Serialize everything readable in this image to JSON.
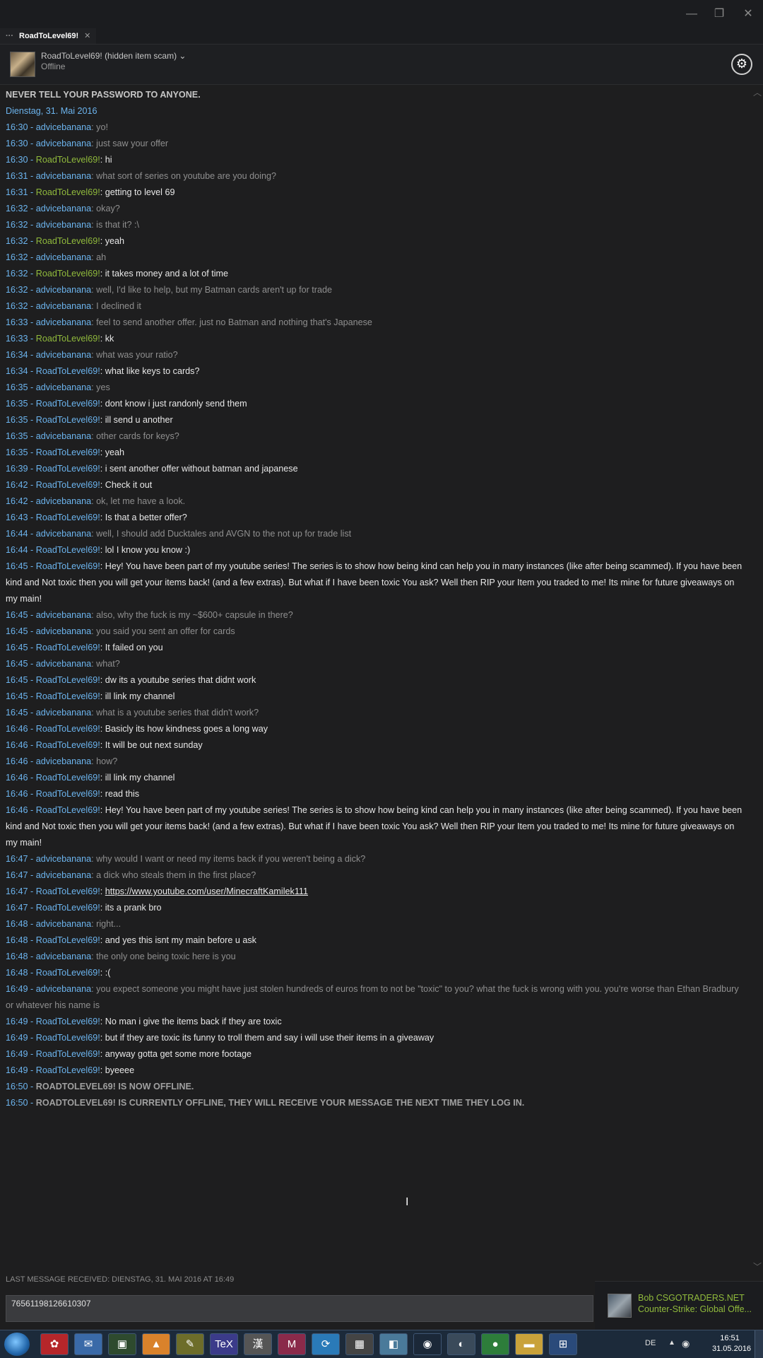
{
  "window": {
    "minimize": "—",
    "restore": "❐",
    "close": "✕"
  },
  "tab": {
    "dots": "···",
    "label": "RoadToLevel69!",
    "close": "✕"
  },
  "header": {
    "contact_name": "RoadToLevel69! (hidden item scam) ⌄",
    "status": "Offline",
    "settings": "⚙"
  },
  "chat": {
    "warning": "NEVER TELL YOUR PASSWORD TO ANYONE.",
    "date": "Dienstag, 31. Mai 2016",
    "messages": [
      {
        "t": "16:30",
        "n": "advicebanana",
        "s": "them",
        "m": "yo!"
      },
      {
        "t": "16:30",
        "n": "advicebanana",
        "s": "them",
        "m": "just saw your offer"
      },
      {
        "t": "16:30",
        "n": "RoadToLevel69!",
        "s": "other",
        "m": "hi"
      },
      {
        "t": "16:31",
        "n": "advicebanana",
        "s": "them",
        "m": "what sort of series on youtube are you doing?"
      },
      {
        "t": "16:31",
        "n": "RoadToLevel69!",
        "s": "other",
        "m": "getting to level 69"
      },
      {
        "t": "16:32",
        "n": "advicebanana",
        "s": "them",
        "m": "okay?"
      },
      {
        "t": "16:32",
        "n": "advicebanana",
        "s": "them",
        "m": "is that it? :\\"
      },
      {
        "t": "16:32",
        "n": "RoadToLevel69!",
        "s": "other",
        "m": "yeah"
      },
      {
        "t": "16:32",
        "n": "advicebanana",
        "s": "them",
        "m": "ah"
      },
      {
        "t": "16:32",
        "n": "RoadToLevel69!",
        "s": "other",
        "m": "it takes money and a lot of time"
      },
      {
        "t": "16:32",
        "n": "advicebanana",
        "s": "them",
        "m": "well, I'd like to help, but my Batman cards aren't up for trade"
      },
      {
        "t": "16:32",
        "n": "advicebanana",
        "s": "them",
        "m": "I declined it"
      },
      {
        "t": "16:33",
        "n": "advicebanana",
        "s": "them",
        "m": "feel to send another offer. just no Batman and nothing that's Japanese"
      },
      {
        "t": "16:33",
        "n": "RoadToLevel69!",
        "s": "other",
        "m": "kk"
      },
      {
        "t": "16:34",
        "n": "advicebanana",
        "s": "them",
        "m": "what was your ratio?"
      },
      {
        "t": "16:34",
        "n": "RoadToLevel69!",
        "s": "me",
        "m": "what like keys to cards?"
      },
      {
        "t": "16:35",
        "n": "advicebanana",
        "s": "them",
        "m": "yes"
      },
      {
        "t": "16:35",
        "n": "RoadToLevel69!",
        "s": "me",
        "m": "dont know i just randonly send them"
      },
      {
        "t": "16:35",
        "n": "RoadToLevel69!",
        "s": "me",
        "m": "ill send u another"
      },
      {
        "t": "16:35",
        "n": "advicebanana",
        "s": "them",
        "m": "other cards for keys?"
      },
      {
        "t": "16:35",
        "n": "RoadToLevel69!",
        "s": "me",
        "m": "yeah"
      },
      {
        "t": "16:39",
        "n": "RoadToLevel69!",
        "s": "me",
        "m": "i sent another offer without batman and japanese"
      },
      {
        "t": "16:42",
        "n": "RoadToLevel69!",
        "s": "me",
        "m": "Check it out"
      },
      {
        "t": "16:42",
        "n": "advicebanana",
        "s": "them",
        "m": "ok, let me have a look."
      },
      {
        "t": "16:43",
        "n": "RoadToLevel69!",
        "s": "me",
        "m": "Is that a better offer?"
      },
      {
        "t": "16:44",
        "n": "advicebanana",
        "s": "them",
        "m": "well, I should add Ducktales and AVGN to the not up for trade list"
      },
      {
        "t": "16:44",
        "n": "RoadToLevel69!",
        "s": "me",
        "m": "lol I know you know :)"
      },
      {
        "t": "16:45",
        "n": "RoadToLevel69!",
        "s": "me",
        "m": "Hey! You have been part of my youtube series! The series is to show how being kind can help you in many instances (like after being scammed). If you have been kind and Not toxic then you will get your items back! (and a few extras). But what if I have been toxic You ask? Well then RIP your Item you traded to me! Its mine for future giveaways on my main!"
      },
      {
        "t": "16:45",
        "n": "advicebanana",
        "s": "them",
        "m": "also, why  the fuck is my ~$600+ capsule in there?"
      },
      {
        "t": "16:45",
        "n": "advicebanana",
        "s": "them",
        "m": "you said you sent an offer for cards"
      },
      {
        "t": "16:45",
        "n": "RoadToLevel69!",
        "s": "me",
        "m": "It failed on you"
      },
      {
        "t": "16:45",
        "n": "advicebanana",
        "s": "them",
        "m": "what?"
      },
      {
        "t": "16:45",
        "n": "RoadToLevel69!",
        "s": "me",
        "m": "dw its a youtube series that didnt work"
      },
      {
        "t": "16:45",
        "n": "RoadToLevel69!",
        "s": "me",
        "m": "ill link my channel"
      },
      {
        "t": "16:45",
        "n": "advicebanana",
        "s": "them",
        "m": "what is a youtube series that didn't work?"
      },
      {
        "t": "16:46",
        "n": "RoadToLevel69!",
        "s": "me",
        "m": "Basicly its how kindness goes a long way"
      },
      {
        "t": "16:46",
        "n": "RoadToLevel69!",
        "s": "me",
        "m": "It will be out next sunday"
      },
      {
        "t": "16:46",
        "n": "advicebanana",
        "s": "them",
        "m": "how?"
      },
      {
        "t": "16:46",
        "n": "RoadToLevel69!",
        "s": "me",
        "m": "ill link my channel"
      },
      {
        "t": "16:46",
        "n": "RoadToLevel69!",
        "s": "me",
        "m": "read this"
      },
      {
        "t": "16:46",
        "n": "RoadToLevel69!",
        "s": "me",
        "m": "Hey! You have been part of my youtube series! The series is to show how being kind can help you in many instances (like after being scammed). If you have been kind and Not toxic then you will get your items back! (and a few extras). But what if I have been toxic You ask? Well then RIP your Item you traded to me! Its mine for future giveaways on my main!"
      },
      {
        "t": "16:47",
        "n": "advicebanana",
        "s": "them",
        "m": "why would I want or need my items back if you weren't being a dick?"
      },
      {
        "t": "16:47",
        "n": "advicebanana",
        "s": "them",
        "m": "a dick who steals them in the first place?"
      },
      {
        "t": "16:47",
        "n": "RoadToLevel69!",
        "s": "me",
        "m": "https://www.youtube.com/user/MinecraftKamilek111",
        "link": true
      },
      {
        "t": "16:47",
        "n": "RoadToLevel69!",
        "s": "me",
        "m": "its a prank bro"
      },
      {
        "t": "16:48",
        "n": "advicebanana",
        "s": "them",
        "m": "right..."
      },
      {
        "t": "16:48",
        "n": "RoadToLevel69!",
        "s": "me",
        "m": "and yes this isnt my main before u ask"
      },
      {
        "t": "16:48",
        "n": "advicebanana",
        "s": "them",
        "m": "the only one being toxic here is you"
      },
      {
        "t": "16:48",
        "n": "RoadToLevel69!",
        "s": "me",
        "m": ":("
      },
      {
        "t": "16:49",
        "n": "advicebanana",
        "s": "them",
        "m": "you expect someone you might have just stolen hundreds of euros from to not be \"toxic\" to you? what the fuck is wrong with you. you're worse than Ethan Bradbury or whatever his name is"
      },
      {
        "t": "16:49",
        "n": "RoadToLevel69!",
        "s": "me",
        "m": "No man i give the items back if they are toxic"
      },
      {
        "t": "16:49",
        "n": "RoadToLevel69!",
        "s": "me",
        "m": "but if they are toxic its funny to troll them and say i will use their items in a giveaway"
      },
      {
        "t": "16:49",
        "n": "RoadToLevel69!",
        "s": "me",
        "m": "anyway gotta get some more footage"
      },
      {
        "t": "16:49",
        "n": "RoadToLevel69!",
        "s": "me",
        "m": "byeeee"
      }
    ],
    "system": [
      {
        "t": "16:50",
        "n": "ROADTOLEVEL69!",
        "m": "IS NOW OFFLINE."
      },
      {
        "t": "16:50",
        "n": "ROADTOLEVEL69!",
        "m": "IS CURRENTLY OFFLINE, THEY WILL RECEIVE YOUR MESSAGE THE NEXT TIME THEY LOG IN."
      }
    ]
  },
  "footer": {
    "last_received": "LAST MESSAGE RECEIVED: DIENSTAG, 31. MAI 2016 AT 16:49",
    "input_value": "76561198126610307"
  },
  "notification": {
    "name": "Bob CSGOTRADERS.NET",
    "game": "Counter-Strike: Global Offe..."
  },
  "taskbar": {
    "apps": [
      {
        "icon": "flower-icon",
        "glyph": "✿"
      },
      {
        "icon": "thunderbird-icon",
        "glyph": "✉"
      },
      {
        "icon": "terminal-icon",
        "glyph": "▣"
      },
      {
        "icon": "vlc-icon",
        "glyph": "▲"
      },
      {
        "icon": "notepad-icon",
        "glyph": "✎"
      },
      {
        "icon": "tex-icon",
        "glyph": "TeX"
      },
      {
        "icon": "kanji-icon",
        "glyph": "漢"
      },
      {
        "icon": "m-icon",
        "glyph": "M"
      },
      {
        "icon": "sync-icon",
        "glyph": "⟳"
      },
      {
        "icon": "calculator-icon",
        "glyph": "▦"
      },
      {
        "icon": "editor-icon",
        "glyph": "◧"
      },
      {
        "icon": "steam-icon",
        "glyph": "◉"
      },
      {
        "icon": "teamspeak-icon",
        "glyph": "◐"
      },
      {
        "icon": "chrome-icon",
        "glyph": "●"
      },
      {
        "icon": "folder-icon",
        "glyph": "▬"
      },
      {
        "icon": "network-icon",
        "glyph": "⊞"
      }
    ],
    "lang": "DE",
    "time": "16:51",
    "date": "31.05.2016"
  }
}
